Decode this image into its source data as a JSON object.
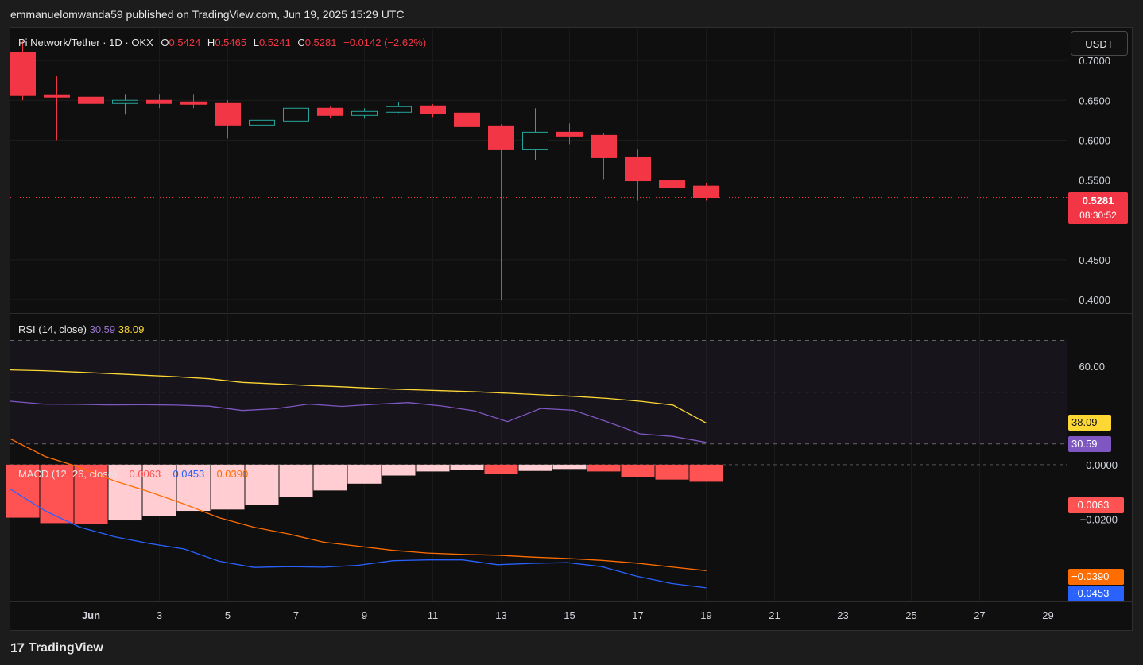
{
  "header": {
    "publisher_line": "emmanuelomwanda59 published on TradingView.com, Jun 19, 2025 15:29 UTC"
  },
  "currency_button": "USDT",
  "footer": {
    "logo_glyph": "17",
    "brand": "TradingView"
  },
  "legend": {
    "symbol": "Pi Network/Tether · 1D · OKX",
    "o_label": "O",
    "o_value": "0.5424",
    "h_label": "H",
    "h_value": "0.5465",
    "l_label": "L",
    "l_value": "0.5241",
    "c_label": "C",
    "c_value": "0.5281",
    "change": "−0.0142 (−2.62%)"
  },
  "rsi_legend": {
    "label": "RSI (14, close)",
    "rsi_value": "30.59",
    "ma_value": "38.09"
  },
  "macd_legend": {
    "label": "MACD (12, 26, close)",
    "hist_value": "−0.0063",
    "macd_value": "−0.0453",
    "signal_value": "−0.0390"
  },
  "price_tag": {
    "price": "0.5281",
    "countdown": "08:30:52"
  },
  "colors": {
    "up": "#26a69a",
    "down": "#f23645",
    "rsi": "#7e57c2",
    "rsi_ma": "#fdd835",
    "macd": "#2962ff",
    "signal": "#ff6d00",
    "hist_neg_strong": "#ff5252",
    "hist_neg_weak": "#ffcdd2"
  },
  "chart_data": [
    {
      "type": "candlestick",
      "title": "Pi Network/Tether · 1D · OKX",
      "x_ticks": [
        "Jun",
        "3",
        "5",
        "7",
        "9",
        "11",
        "13",
        "15",
        "17",
        "19",
        "21",
        "23",
        "25",
        "27",
        "29"
      ],
      "y_ticks": [
        "0.7000",
        "0.6500",
        "0.6000",
        "0.5500",
        "0.4500",
        "0.4000"
      ],
      "ylim": [
        0.385,
        0.74
      ],
      "candles": [
        {
          "date": "May 30",
          "o": 0.71,
          "h": 0.725,
          "l": 0.65,
          "c": 0.656
        },
        {
          "date": "May 31",
          "o": 0.657,
          "h": 0.68,
          "l": 0.6,
          "c": 0.654
        },
        {
          "date": "Jun 1",
          "o": 0.654,
          "h": 0.657,
          "l": 0.627,
          "c": 0.646
        },
        {
          "date": "Jun 2",
          "o": 0.646,
          "h": 0.658,
          "l": 0.632,
          "c": 0.65
        },
        {
          "date": "Jun 3",
          "o": 0.65,
          "h": 0.658,
          "l": 0.64,
          "c": 0.646
        },
        {
          "date": "Jun 4",
          "o": 0.648,
          "h": 0.658,
          "l": 0.64,
          "c": 0.645
        },
        {
          "date": "Jun 5",
          "o": 0.646,
          "h": 0.65,
          "l": 0.602,
          "c": 0.619
        },
        {
          "date": "Jun 6",
          "o": 0.619,
          "h": 0.629,
          "l": 0.612,
          "c": 0.625
        },
        {
          "date": "Jun 7",
          "o": 0.624,
          "h": 0.658,
          "l": 0.622,
          "c": 0.64
        },
        {
          "date": "Jun 8",
          "o": 0.64,
          "h": 0.642,
          "l": 0.628,
          "c": 0.631
        },
        {
          "date": "Jun 9",
          "o": 0.631,
          "h": 0.64,
          "l": 0.627,
          "c": 0.636
        },
        {
          "date": "Jun 10",
          "o": 0.635,
          "h": 0.648,
          "l": 0.634,
          "c": 0.642
        },
        {
          "date": "Jun 11",
          "o": 0.643,
          "h": 0.645,
          "l": 0.629,
          "c": 0.633
        },
        {
          "date": "Jun 12",
          "o": 0.634,
          "h": 0.635,
          "l": 0.607,
          "c": 0.617
        },
        {
          "date": "Jun 13",
          "o": 0.618,
          "h": 0.62,
          "l": 0.4,
          "c": 0.588
        },
        {
          "date": "Jun 14",
          "o": 0.588,
          "h": 0.64,
          "l": 0.575,
          "c": 0.61
        },
        {
          "date": "Jun 15",
          "o": 0.61,
          "h": 0.621,
          "l": 0.595,
          "c": 0.605
        },
        {
          "date": "Jun 16",
          "o": 0.606,
          "h": 0.609,
          "l": 0.551,
          "c": 0.578
        },
        {
          "date": "Jun 17",
          "o": 0.579,
          "h": 0.588,
          "l": 0.524,
          "c": 0.549
        },
        {
          "date": "Jun 18",
          "o": 0.549,
          "h": 0.564,
          "l": 0.522,
          "c": 0.541
        },
        {
          "date": "Jun 19",
          "o": 0.5424,
          "h": 0.5465,
          "l": 0.5241,
          "c": 0.5281
        }
      ],
      "last_price": 0.5281
    },
    {
      "type": "line",
      "title": "RSI (14, close)",
      "y_ticks": [
        "60.00"
      ],
      "ylim": [
        25,
        80
      ],
      "levels": [
        70,
        50,
        30
      ],
      "series": [
        {
          "name": "30.59",
          "values": [
            46.5,
            45.4,
            45.3,
            45.1,
            45.2,
            45.0,
            44.6,
            42.9,
            43.6,
            45.4,
            44.5,
            45.3,
            46.0,
            44.7,
            42.8,
            38.6,
            43.7,
            43.0,
            38.6,
            33.9,
            32.9,
            30.6
          ]
        },
        {
          "name": "38.09",
          "values": [
            58.6,
            58.3,
            57.8,
            57.2,
            56.6,
            56.0,
            55.2,
            53.8,
            53.2,
            52.6,
            52.1,
            51.5,
            51.0,
            50.6,
            50.2,
            49.6,
            49.0,
            48.4,
            47.6,
            46.5,
            45.0,
            38.09
          ]
        }
      ]
    },
    {
      "type": "bar+line",
      "title": "MACD (12, 26, close)",
      "y_ticks": [
        "0.0000",
        "−0.0200"
      ],
      "ylim": [
        -0.05,
        0.002
      ],
      "histogram": [
        -0.0195,
        -0.0215,
        -0.0217,
        -0.0205,
        -0.019,
        -0.017,
        -0.0165,
        -0.0148,
        -0.0118,
        -0.0095,
        -0.007,
        -0.004,
        -0.0025,
        -0.0018,
        -0.0035,
        -0.0023,
        -0.0016,
        -0.0025,
        -0.0045,
        -0.0055,
        -0.0063
      ],
      "series": [
        {
          "name": "−0.0453",
          "values": [
            -0.009,
            -0.017,
            -0.023,
            -0.0265,
            -0.029,
            -0.031,
            -0.0355,
            -0.0378,
            -0.0375,
            -0.0377,
            -0.037,
            -0.0353,
            -0.035,
            -0.035,
            -0.0368,
            -0.0363,
            -0.036,
            -0.0375,
            -0.041,
            -0.0437,
            -0.0453
          ]
        },
        {
          "name": "−0.0390",
          "values": [
            0.0095,
            0.003,
            -0.001,
            -0.006,
            -0.01,
            -0.0145,
            -0.0195,
            -0.023,
            -0.0255,
            -0.0285,
            -0.03,
            -0.0315,
            -0.0325,
            -0.033,
            -0.0333,
            -0.034,
            -0.0345,
            -0.0352,
            -0.0362,
            -0.0376,
            -0.039
          ]
        }
      ]
    }
  ]
}
